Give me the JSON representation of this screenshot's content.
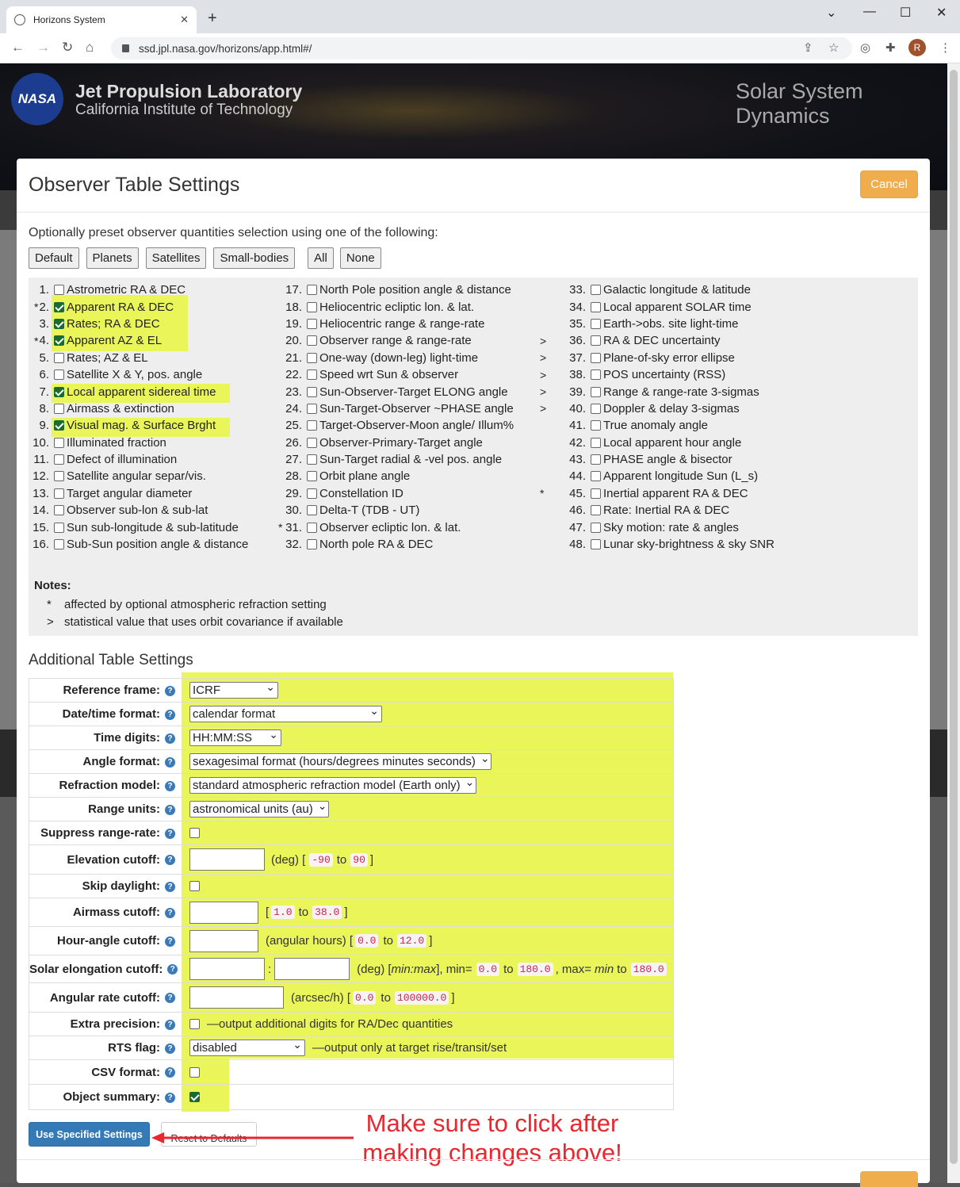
{
  "browser": {
    "tab_title": "Horizons System",
    "url": "ssd.jpl.nasa.gov/horizons/app.html#/",
    "profile_initial": "R"
  },
  "banner": {
    "logo_text": "NASA",
    "org_line1": "Jet Propulsion Laboratory",
    "org_line2": "California Institute of Technology",
    "right_title": "Solar System Dynamics"
  },
  "modal": {
    "title": "Observer Table Settings",
    "cancel_label": "Cancel",
    "preset_label": "Optionally preset observer quantities selection using one of the following:",
    "presets": [
      "Default",
      "Planets",
      "Satellites",
      "Small-bodies",
      "All",
      "None"
    ],
    "quantities_col1": [
      {
        "mark": "",
        "num": "1.",
        "label": "Astrometric RA & DEC",
        "checked": false
      },
      {
        "mark": "*",
        "num": "2.",
        "label": "Apparent RA & DEC",
        "checked": true
      },
      {
        "mark": "",
        "num": "3.",
        "label": "Rates; RA & DEC",
        "checked": true
      },
      {
        "mark": "*",
        "num": "4.",
        "label": "Apparent AZ & EL",
        "checked": true
      },
      {
        "mark": "",
        "num": "5.",
        "label": "Rates; AZ & EL",
        "checked": false
      },
      {
        "mark": "",
        "num": "6.",
        "label": "Satellite X & Y, pos. angle",
        "checked": false
      },
      {
        "mark": "",
        "num": "7.",
        "label": "Local apparent sidereal time",
        "checked": true
      },
      {
        "mark": "",
        "num": "8.",
        "label": "Airmass & extinction",
        "checked": false
      },
      {
        "mark": "",
        "num": "9.",
        "label": "Visual mag. & Surface Brght",
        "checked": true
      },
      {
        "mark": "",
        "num": "10.",
        "label": "Illuminated fraction",
        "checked": false
      },
      {
        "mark": "",
        "num": "11.",
        "label": "Defect of illumination",
        "checked": false
      },
      {
        "mark": "",
        "num": "12.",
        "label": "Satellite angular separ/vis.",
        "checked": false
      },
      {
        "mark": "",
        "num": "13.",
        "label": "Target angular diameter",
        "checked": false
      },
      {
        "mark": "",
        "num": "14.",
        "label": "Observer sub-lon & sub-lat",
        "checked": false
      },
      {
        "mark": "",
        "num": "15.",
        "label": "Sun sub-longitude & sub-latitude",
        "checked": false
      },
      {
        "mark": "",
        "num": "16.",
        "label": "Sub-Sun position angle & distance",
        "checked": false
      }
    ],
    "quantities_col2": [
      {
        "mark": "",
        "num": "17.",
        "label": "North Pole position angle & distance",
        "checked": false
      },
      {
        "mark": "",
        "num": "18.",
        "label": "Heliocentric ecliptic lon. & lat.",
        "checked": false
      },
      {
        "mark": "",
        "num": "19.",
        "label": "Heliocentric range & range-rate",
        "checked": false
      },
      {
        "mark": "",
        "num": "20.",
        "label": "Observer range & range-rate",
        "checked": false
      },
      {
        "mark": "",
        "num": "21.",
        "label": "One-way (down-leg) light-time",
        "checked": false
      },
      {
        "mark": "",
        "num": "22.",
        "label": "Speed wrt Sun & observer",
        "checked": false
      },
      {
        "mark": "",
        "num": "23.",
        "label": "Sun-Observer-Target ELONG angle",
        "checked": false
      },
      {
        "mark": "",
        "num": "24.",
        "label": "Sun-Target-Observer ~PHASE angle",
        "checked": false
      },
      {
        "mark": "",
        "num": "25.",
        "label": "Target-Observer-Moon angle/ Illum%",
        "checked": false
      },
      {
        "mark": "",
        "num": "26.",
        "label": "Observer-Primary-Target angle",
        "checked": false
      },
      {
        "mark": "",
        "num": "27.",
        "label": "Sun-Target radial & -vel pos. angle",
        "checked": false
      },
      {
        "mark": "",
        "num": "28.",
        "label": "Orbit plane angle",
        "checked": false
      },
      {
        "mark": "",
        "num": "29.",
        "label": "Constellation ID",
        "checked": false
      },
      {
        "mark": "",
        "num": "30.",
        "label": "Delta-T (TDB - UT)",
        "checked": false
      },
      {
        "mark": "*",
        "num": "31.",
        "label": "Observer ecliptic lon. & lat.",
        "checked": false
      },
      {
        "mark": "",
        "num": "32.",
        "label": "North pole RA & DEC",
        "checked": false
      }
    ],
    "quantities_col3": [
      {
        "mark": "",
        "num": "33.",
        "label": "Galactic longitude & latitude",
        "checked": false
      },
      {
        "mark": "",
        "num": "34.",
        "label": "Local apparent SOLAR time",
        "checked": false
      },
      {
        "mark": "",
        "num": "35.",
        "label": "Earth->obs. site light-time",
        "checked": false
      },
      {
        "mark": ">",
        "num": "36.",
        "label": "RA & DEC uncertainty",
        "checked": false
      },
      {
        "mark": ">",
        "num": "37.",
        "label": "Plane-of-sky error ellipse",
        "checked": false
      },
      {
        "mark": ">",
        "num": "38.",
        "label": "POS uncertainty (RSS)",
        "checked": false
      },
      {
        "mark": ">",
        "num": "39.",
        "label": "Range & range-rate 3-sigmas",
        "checked": false
      },
      {
        "mark": ">",
        "num": "40.",
        "label": "Doppler & delay 3-sigmas",
        "checked": false
      },
      {
        "mark": "",
        "num": "41.",
        "label": "True anomaly angle",
        "checked": false
      },
      {
        "mark": "",
        "num": "42.",
        "label": "Local apparent hour angle",
        "checked": false
      },
      {
        "mark": "",
        "num": "43.",
        "label": "PHASE angle & bisector",
        "checked": false
      },
      {
        "mark": "",
        "num": "44.",
        "label": "Apparent longitude Sun (L_s)",
        "checked": false
      },
      {
        "mark": "*",
        "num": "45.",
        "label": "Inertial apparent RA & DEC",
        "checked": false
      },
      {
        "mark": "",
        "num": "46.",
        "label": "Rate: Inertial RA & DEC",
        "checked": false
      },
      {
        "mark": "",
        "num": "47.",
        "label": "Sky motion: rate & angles",
        "checked": false
      },
      {
        "mark": "",
        "num": "48.",
        "label": "Lunar sky-brightness & sky SNR",
        "checked": false
      }
    ],
    "notes_title": "Notes:",
    "notes": [
      {
        "sym": "*",
        "text": "affected by optional atmospheric refraction setting"
      },
      {
        "sym": ">",
        "text": "statistical value that uses orbit covariance if available"
      }
    ],
    "additional_title": "Additional Table Settings",
    "settings": {
      "ref_frame": {
        "label": "Reference frame:",
        "value": "ICRF"
      },
      "date_format": {
        "label": "Date/time format:",
        "value": "calendar format"
      },
      "time_digits": {
        "label": "Time digits:",
        "value": "HH:MM:SS"
      },
      "angle_format": {
        "label": "Angle format:",
        "value": "sexagesimal format (hours/degrees minutes seconds)"
      },
      "refraction": {
        "label": "Refraction model:",
        "value": "standard atmospheric refraction model (Earth only)"
      },
      "range_units": {
        "label": "Range units:",
        "value": "astronomical units (au)"
      },
      "suppress": {
        "label": "Suppress range-rate:",
        "checked": false
      },
      "elevation": {
        "label": "Elevation cutoff:",
        "unit": "(deg) [",
        "min": "-90",
        "to": "to",
        "max": "90",
        "close": "]"
      },
      "skip_daylight": {
        "label": "Skip daylight:",
        "checked": false
      },
      "airmass": {
        "label": "Airmass cutoff:",
        "open": "[",
        "min": "1.0",
        "to": "to",
        "max": "38.0",
        "close": "]"
      },
      "hour_angle": {
        "label": "Hour-angle cutoff:",
        "unit": "(angular hours) [",
        "min": "0.0",
        "to": "to",
        "max": "12.0",
        "close": "]"
      },
      "solar_elong": {
        "label": "Solar elongation cutoff:",
        "sep": ":",
        "unit": "(deg) [",
        "fmt": "min:max",
        "p1": "], min=",
        "min1": "0.0",
        "to1": "to",
        "max1": "180.0",
        "p2": ", max=",
        "mintxt": "min",
        "to2": "to",
        "max2": "180.0"
      },
      "ang_rate": {
        "label": "Angular rate cutoff:",
        "unit": "(arcsec/h) [",
        "min": "0.0",
        "to": "to",
        "max": "100000.0",
        "close": "]"
      },
      "extra_precision": {
        "label": "Extra precision:",
        "checked": false,
        "desc": "—output additional digits for RA/Dec quantities"
      },
      "rts_flag": {
        "label": "RTS flag:",
        "value": "disabled",
        "desc": "—output only at target rise/transit/set"
      },
      "csv": {
        "label": "CSV format:",
        "checked": false
      },
      "obj_summary": {
        "label": "Object summary:",
        "checked": true
      }
    },
    "use_label": "Use Specified Settings",
    "reset_label": "Reset to Defaults",
    "annotation": "Make sure to click after making changes above!"
  }
}
